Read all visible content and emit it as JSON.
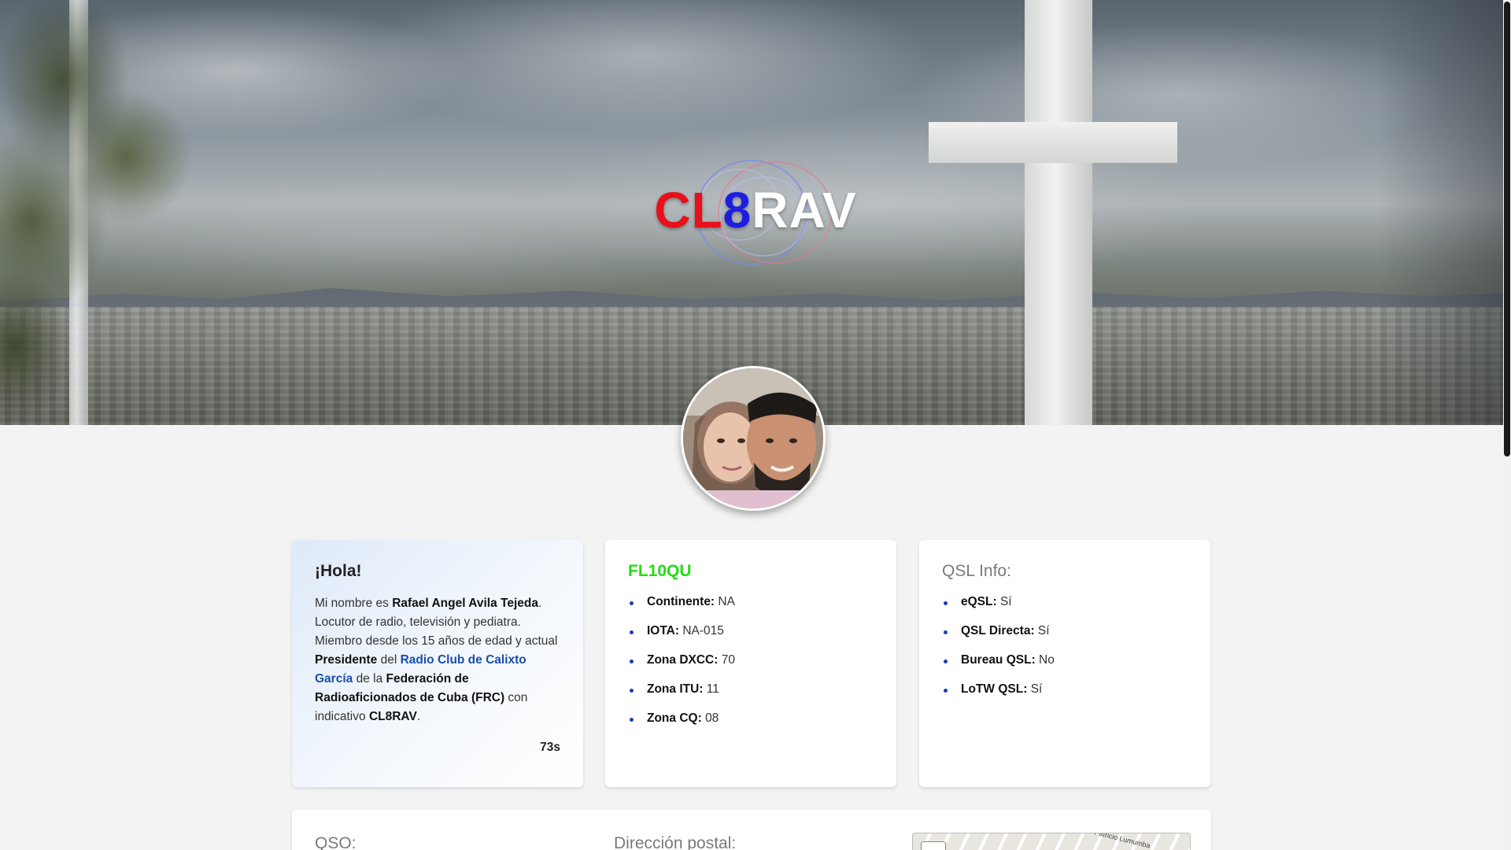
{
  "header": {
    "logo": {
      "part1": "CL",
      "part2": "8",
      "part3": "RAV",
      "colors": {
        "part1": "#e8101a",
        "part2": "#1c1ee0",
        "part3": "#ffffff"
      }
    }
  },
  "intro": {
    "title": "¡Hola!",
    "bio": {
      "t1": "Mi nombre es ",
      "name": "Rafael Angel Avila Tejeda",
      "t2": ". Locutor de radio, televisión y pediatra. Miembro desde los 15 años de edad y actual ",
      "role": "Presidente",
      "t3": " del ",
      "club": "Radio Club de Calixto García",
      "t4": " de la ",
      "federation": "Federación de Radioaficionados de Cuba (FRC)",
      "t5": " con indicativo ",
      "callsign": "CL8RAV",
      "t6": "."
    },
    "signoff": "73s"
  },
  "station": {
    "title": "FL10QU",
    "title_color": "#22dd11",
    "items": [
      {
        "label": "Continente:",
        "value": "NA"
      },
      {
        "label": "IOTA:",
        "value": "NA-015"
      },
      {
        "label": "Zona DXCC:",
        "value": "70"
      },
      {
        "label": "Zona ITU:",
        "value": "11"
      },
      {
        "label": "Zona CQ:",
        "value": "08"
      }
    ]
  },
  "qsl": {
    "title": "QSL Info:",
    "items": [
      {
        "label": "eQSL:",
        "value": "Sí"
      },
      {
        "label": "QSL Directa:",
        "value": "Sí"
      },
      {
        "label": "Bureau QSL:",
        "value": "No"
      },
      {
        "label": "LoTW QSL:",
        "value": "Sí"
      }
    ]
  },
  "bottom": {
    "qso_title": "QSO:",
    "address_title": "Dirección postal:",
    "map_street": "Patricio Lumumba"
  },
  "colors": {
    "accent_link": "#1a4fa8",
    "bullet": "#1a3fb4"
  }
}
